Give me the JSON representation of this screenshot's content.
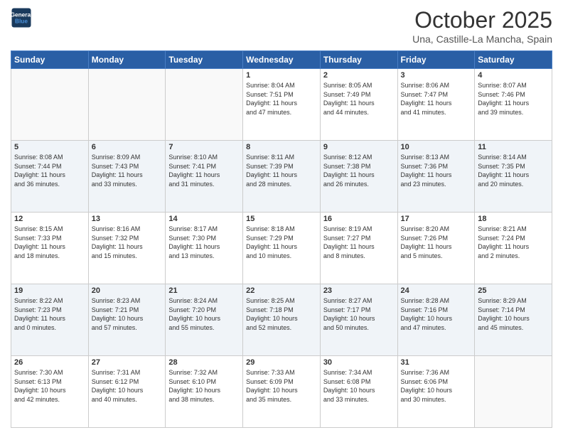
{
  "header": {
    "logo_line1": "General",
    "logo_line2": "Blue",
    "month_title": "October 2025",
    "location": "Una, Castille-La Mancha, Spain"
  },
  "days_of_week": [
    "Sunday",
    "Monday",
    "Tuesday",
    "Wednesday",
    "Thursday",
    "Friday",
    "Saturday"
  ],
  "weeks": [
    {
      "shaded": false,
      "days": [
        {
          "num": "",
          "info": ""
        },
        {
          "num": "",
          "info": ""
        },
        {
          "num": "",
          "info": ""
        },
        {
          "num": "1",
          "info": "Sunrise: 8:04 AM\nSunset: 7:51 PM\nDaylight: 11 hours\nand 47 minutes."
        },
        {
          "num": "2",
          "info": "Sunrise: 8:05 AM\nSunset: 7:49 PM\nDaylight: 11 hours\nand 44 minutes."
        },
        {
          "num": "3",
          "info": "Sunrise: 8:06 AM\nSunset: 7:47 PM\nDaylight: 11 hours\nand 41 minutes."
        },
        {
          "num": "4",
          "info": "Sunrise: 8:07 AM\nSunset: 7:46 PM\nDaylight: 11 hours\nand 39 minutes."
        }
      ]
    },
    {
      "shaded": true,
      "days": [
        {
          "num": "5",
          "info": "Sunrise: 8:08 AM\nSunset: 7:44 PM\nDaylight: 11 hours\nand 36 minutes."
        },
        {
          "num": "6",
          "info": "Sunrise: 8:09 AM\nSunset: 7:43 PM\nDaylight: 11 hours\nand 33 minutes."
        },
        {
          "num": "7",
          "info": "Sunrise: 8:10 AM\nSunset: 7:41 PM\nDaylight: 11 hours\nand 31 minutes."
        },
        {
          "num": "8",
          "info": "Sunrise: 8:11 AM\nSunset: 7:39 PM\nDaylight: 11 hours\nand 28 minutes."
        },
        {
          "num": "9",
          "info": "Sunrise: 8:12 AM\nSunset: 7:38 PM\nDaylight: 11 hours\nand 26 minutes."
        },
        {
          "num": "10",
          "info": "Sunrise: 8:13 AM\nSunset: 7:36 PM\nDaylight: 11 hours\nand 23 minutes."
        },
        {
          "num": "11",
          "info": "Sunrise: 8:14 AM\nSunset: 7:35 PM\nDaylight: 11 hours\nand 20 minutes."
        }
      ]
    },
    {
      "shaded": false,
      "days": [
        {
          "num": "12",
          "info": "Sunrise: 8:15 AM\nSunset: 7:33 PM\nDaylight: 11 hours\nand 18 minutes."
        },
        {
          "num": "13",
          "info": "Sunrise: 8:16 AM\nSunset: 7:32 PM\nDaylight: 11 hours\nand 15 minutes."
        },
        {
          "num": "14",
          "info": "Sunrise: 8:17 AM\nSunset: 7:30 PM\nDaylight: 11 hours\nand 13 minutes."
        },
        {
          "num": "15",
          "info": "Sunrise: 8:18 AM\nSunset: 7:29 PM\nDaylight: 11 hours\nand 10 minutes."
        },
        {
          "num": "16",
          "info": "Sunrise: 8:19 AM\nSunset: 7:27 PM\nDaylight: 11 hours\nand 8 minutes."
        },
        {
          "num": "17",
          "info": "Sunrise: 8:20 AM\nSunset: 7:26 PM\nDaylight: 11 hours\nand 5 minutes."
        },
        {
          "num": "18",
          "info": "Sunrise: 8:21 AM\nSunset: 7:24 PM\nDaylight: 11 hours\nand 2 minutes."
        }
      ]
    },
    {
      "shaded": true,
      "days": [
        {
          "num": "19",
          "info": "Sunrise: 8:22 AM\nSunset: 7:23 PM\nDaylight: 11 hours\nand 0 minutes."
        },
        {
          "num": "20",
          "info": "Sunrise: 8:23 AM\nSunset: 7:21 PM\nDaylight: 10 hours\nand 57 minutes."
        },
        {
          "num": "21",
          "info": "Sunrise: 8:24 AM\nSunset: 7:20 PM\nDaylight: 10 hours\nand 55 minutes."
        },
        {
          "num": "22",
          "info": "Sunrise: 8:25 AM\nSunset: 7:18 PM\nDaylight: 10 hours\nand 52 minutes."
        },
        {
          "num": "23",
          "info": "Sunrise: 8:27 AM\nSunset: 7:17 PM\nDaylight: 10 hours\nand 50 minutes."
        },
        {
          "num": "24",
          "info": "Sunrise: 8:28 AM\nSunset: 7:16 PM\nDaylight: 10 hours\nand 47 minutes."
        },
        {
          "num": "25",
          "info": "Sunrise: 8:29 AM\nSunset: 7:14 PM\nDaylight: 10 hours\nand 45 minutes."
        }
      ]
    },
    {
      "shaded": false,
      "days": [
        {
          "num": "26",
          "info": "Sunrise: 7:30 AM\nSunset: 6:13 PM\nDaylight: 10 hours\nand 42 minutes."
        },
        {
          "num": "27",
          "info": "Sunrise: 7:31 AM\nSunset: 6:12 PM\nDaylight: 10 hours\nand 40 minutes."
        },
        {
          "num": "28",
          "info": "Sunrise: 7:32 AM\nSunset: 6:10 PM\nDaylight: 10 hours\nand 38 minutes."
        },
        {
          "num": "29",
          "info": "Sunrise: 7:33 AM\nSunset: 6:09 PM\nDaylight: 10 hours\nand 35 minutes."
        },
        {
          "num": "30",
          "info": "Sunrise: 7:34 AM\nSunset: 6:08 PM\nDaylight: 10 hours\nand 33 minutes."
        },
        {
          "num": "31",
          "info": "Sunrise: 7:36 AM\nSunset: 6:06 PM\nDaylight: 10 hours\nand 30 minutes."
        },
        {
          "num": "",
          "info": ""
        }
      ]
    }
  ]
}
